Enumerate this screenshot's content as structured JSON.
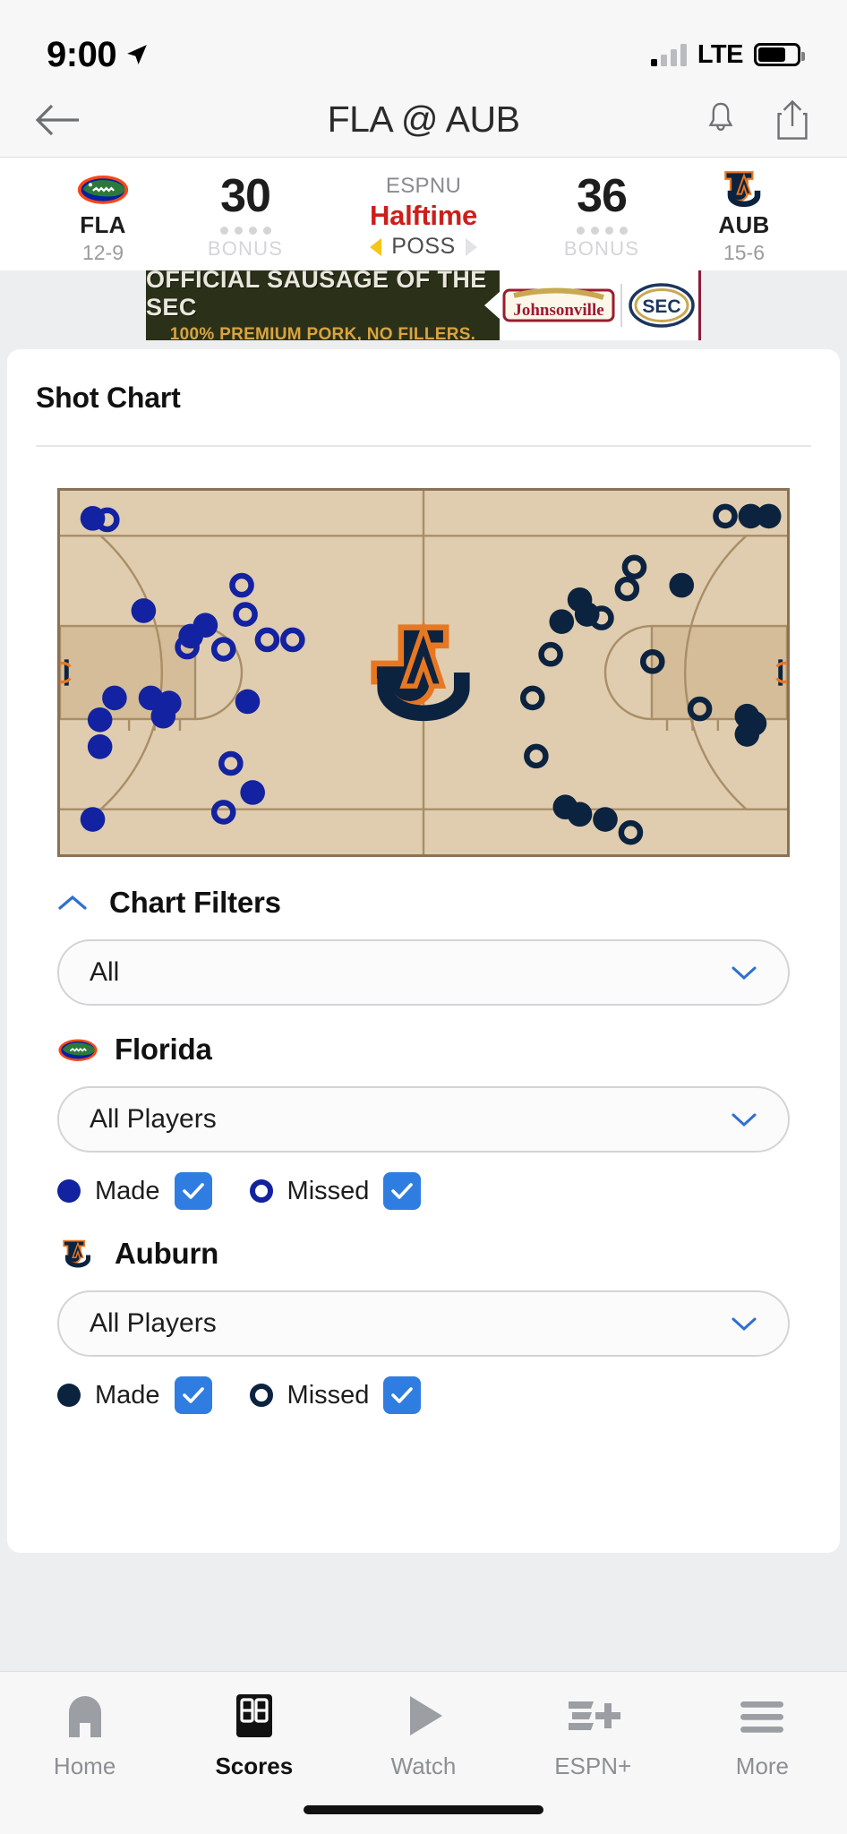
{
  "status_bar": {
    "time": "9:00",
    "location_icon": "location-arrow-icon",
    "network": "LTE",
    "signal_icon": "signal-bars-icon",
    "battery_icon": "battery-icon"
  },
  "nav": {
    "back_icon": "back-arrow-icon",
    "title": "FLA @ AUB",
    "alerts_icon": "bell-icon",
    "share_icon": "share-icon"
  },
  "scoreboard": {
    "away": {
      "abbr": "FLA",
      "record": "12-9",
      "score": "30",
      "bonus_label": "BONUS",
      "logo_icon": "florida-gators-logo"
    },
    "home": {
      "abbr": "AUB",
      "record": "15-6",
      "score": "36",
      "bonus_label": "BONUS",
      "logo_icon": "auburn-tigers-logo"
    },
    "network": "ESPNU",
    "game_state": "Halftime",
    "possession_label": "POSS",
    "possession_side": "left"
  },
  "ad": {
    "headline": "OFFICIAL SAUSAGE OF THE SEC",
    "subline": "100% PREMIUM PORK, NO FILLERS.",
    "brand": "Johnsonville",
    "league_logo": "sec-logo"
  },
  "shot_chart_card": {
    "title": "Shot Chart"
  },
  "filters": {
    "collapse_icon": "chevron-up-icon",
    "title": "Chart Filters",
    "period_select": {
      "value": "All",
      "chevron_icon": "chevron-down-icon"
    },
    "teams": [
      {
        "name": "Florida",
        "logo_icon": "florida-gators-logo",
        "player_select": {
          "value": "All Players",
          "chevron_icon": "chevron-down-icon"
        },
        "made_label": "Made",
        "made_checked": true,
        "missed_label": "Missed",
        "missed_checked": true,
        "color": "#1322A0"
      },
      {
        "name": "Auburn",
        "logo_icon": "auburn-tigers-logo",
        "player_select": {
          "value": "All Players",
          "chevron_icon": "chevron-down-icon"
        },
        "made_label": "Made",
        "made_checked": true,
        "missed_label": "Missed",
        "missed_checked": true,
        "color": "#0C2340"
      }
    ],
    "checkbox_color": "#2F7DE1"
  },
  "tab_bar": {
    "items": [
      {
        "label": "Home",
        "icon": "home-icon",
        "active": false
      },
      {
        "label": "Scores",
        "icon": "scoreboard-icon",
        "active": true
      },
      {
        "label": "Watch",
        "icon": "play-icon",
        "active": false
      },
      {
        "label": "ESPN+",
        "icon": "espn-plus-icon",
        "active": false
      },
      {
        "label": "More",
        "icon": "hamburger-icon",
        "active": false
      }
    ]
  },
  "chart_data": {
    "type": "scatter",
    "title": "Shot Chart",
    "xlabel": "",
    "ylabel": "",
    "xlim": [
      0,
      100
    ],
    "ylim": [
      0,
      50
    ],
    "grid": false,
    "legend_position": "below",
    "court": {
      "fill": "#e0cdaf",
      "paint_fill": "#d5bd99",
      "line_color": "#a98e68",
      "center_logo": "auburn-tigers-logo"
    },
    "series": [
      {
        "name": "Florida - Made",
        "color": "#1322A0",
        "marker": "filled-circle",
        "points": [
          [
            4.5,
            46.2
          ],
          [
            11.5,
            33.5
          ],
          [
            18.0,
            30.0
          ],
          [
            20.0,
            31.5
          ],
          [
            7.5,
            21.5
          ],
          [
            5.5,
            18.5
          ],
          [
            5.5,
            14.8
          ],
          [
            12.5,
            21.5
          ],
          [
            15.0,
            20.8
          ],
          [
            14.2,
            19.0
          ],
          [
            25.8,
            21.0
          ],
          [
            26.5,
            8.5
          ],
          [
            4.5,
            4.8
          ]
        ]
      },
      {
        "name": "Florida - Missed",
        "color": "#1322A0",
        "marker": "open-circle",
        "points": [
          [
            6.5,
            46.0
          ],
          [
            25.0,
            37.0
          ],
          [
            25.5,
            33.0
          ],
          [
            28.5,
            29.5
          ],
          [
            32.0,
            29.5
          ],
          [
            17.5,
            28.5
          ],
          [
            22.5,
            28.2
          ],
          [
            23.5,
            12.5
          ],
          [
            22.5,
            5.8
          ]
        ]
      },
      {
        "name": "Auburn - Made",
        "color": "#0C2340",
        "marker": "filled-circle",
        "points": [
          [
            97.5,
            46.5
          ],
          [
            95.0,
            46.5
          ],
          [
            85.5,
            37.0
          ],
          [
            71.5,
            35.0
          ],
          [
            72.5,
            33.0
          ],
          [
            69.0,
            32.0
          ],
          [
            94.5,
            19.0
          ],
          [
            95.5,
            18.0
          ],
          [
            94.5,
            16.5
          ],
          [
            69.5,
            6.5
          ],
          [
            71.5,
            5.5
          ],
          [
            75.0,
            4.8
          ]
        ]
      },
      {
        "name": "Auburn - Missed",
        "color": "#0C2340",
        "marker": "open-circle",
        "points": [
          [
            91.5,
            46.5
          ],
          [
            79.0,
            39.5
          ],
          [
            78.0,
            36.5
          ],
          [
            74.5,
            32.5
          ],
          [
            67.5,
            27.5
          ],
          [
            81.5,
            26.5
          ],
          [
            65.0,
            21.5
          ],
          [
            88.0,
            20.0
          ],
          [
            65.5,
            13.5
          ],
          [
            78.5,
            3.0
          ]
        ]
      }
    ]
  }
}
